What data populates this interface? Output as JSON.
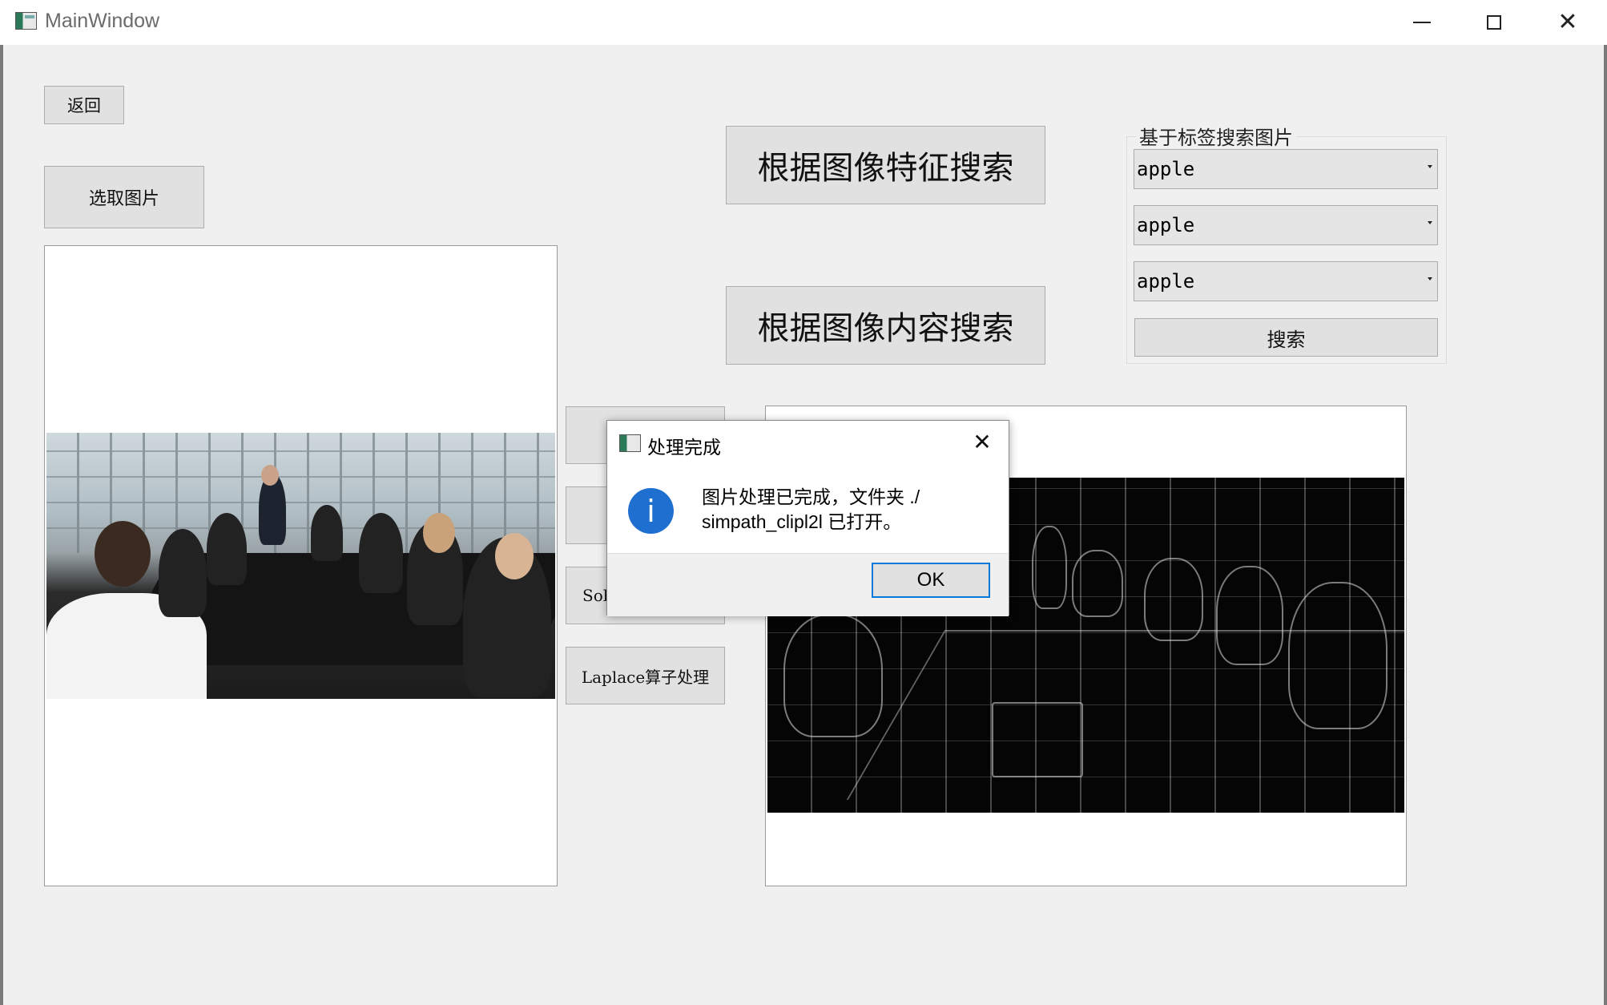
{
  "window": {
    "title": "MainWindow",
    "icons": {
      "app": "app-window-icon",
      "minimize": "minimize-icon",
      "maximize": "maximize-icon",
      "close": "close-icon"
    }
  },
  "toolbar": {
    "back_label": "返回",
    "select_image_label": "选取图片"
  },
  "search": {
    "feature_search_label": "根据图像特征搜索",
    "content_search_label": "根据图像内容搜索"
  },
  "tag_search": {
    "group_title": "基于标签搜索图片",
    "combos": [
      {
        "value": "apple"
      },
      {
        "value": "apple"
      },
      {
        "value": "apple"
      }
    ],
    "search_label": "搜索"
  },
  "operators": {
    "op3_visible_label": "Sob",
    "op4_label": "Laplace算子处理"
  },
  "images": {
    "source_icon": "meeting-photo",
    "result_icon": "edge-detected-photo"
  },
  "dialog": {
    "title": "处理完成",
    "message": "图片处理已完成，文件夹 ./\nsimpath_clipl2l 已打开。",
    "ok_label": "OK",
    "icon": "info-icon",
    "accent_color": "#0078d7"
  }
}
